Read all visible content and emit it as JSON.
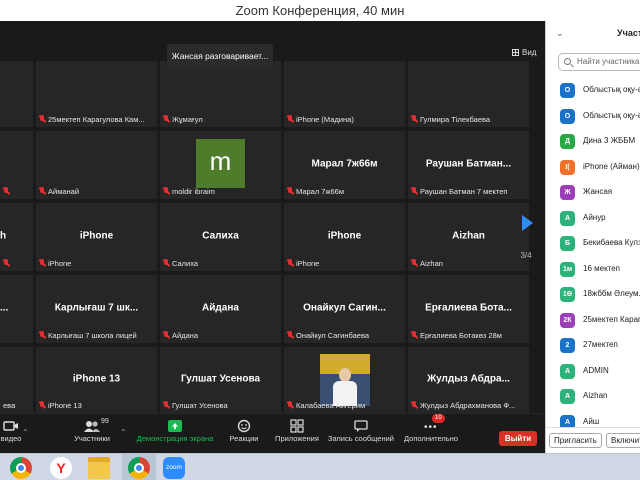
{
  "window": {
    "title": "Zoom Конференция, 40 мин"
  },
  "banner": {
    "speaking": "Жансая разговаривает..."
  },
  "view_button": {
    "label": "Вид"
  },
  "grid": {
    "row1": [
      {
        "caption": ""
      },
      {
        "caption": "25мектеп Карагулова Кам..."
      },
      {
        "caption": "Жұмағул"
      },
      {
        "caption": "iPhone (Мадина)"
      },
      {
        "caption": "Гулмира Тілекбаева"
      }
    ],
    "row2": [
      {
        "caption": ""
      },
      {
        "caption": "Айманай"
      },
      {
        "caption": "moldir ibraim",
        "avatar_letter": "m"
      },
      {
        "big": "Марал 7ж66м",
        "caption": "Марал 7ж66м"
      },
      {
        "big": "Раушан Батман...",
        "caption": "Раушан Батман 7 мектеп"
      }
    ],
    "row3": [
      {
        "big": "h"
      },
      {
        "big": "iPhone",
        "caption": "iPhone"
      },
      {
        "big": "Салиха",
        "caption": "Салиха"
      },
      {
        "big": "iPhone",
        "caption": "iPhone"
      },
      {
        "big": "Aizhan",
        "caption": "Aizhan"
      }
    ],
    "row4": [
      {
        "big": "..."
      },
      {
        "big": "Карлығаш 7 шк...",
        "caption": "Карлығаш 7 школа лицей"
      },
      {
        "big": "Айдана",
        "caption": "Айдана"
      },
      {
        "big": "Онайкул Сагин...",
        "caption": "Онайкул Сагинбаева"
      },
      {
        "big": "Ерғалиева Бота...",
        "caption": "Ерғалиева Ботакөз 28м"
      }
    ],
    "row5": [
      {
        "caption": "ева"
      },
      {
        "big": "iPhone 13",
        "caption": "iPhone 13"
      },
      {
        "big": "Гулшат Усенова",
        "caption": "Гулшат Усенова"
      },
      {
        "caption": "Калабаева Айгерим"
      },
      {
        "big": "Жулдыз Абдра...",
        "caption": "Жулдыз Абдрахманова Ф..."
      }
    ],
    "page_indicator": "3/4"
  },
  "toolbar": {
    "video": "видео",
    "participants": "Участники",
    "participants_count": "99",
    "share": "Демонстрация экрана",
    "reactions": "Реакции",
    "apps": "Приложения",
    "chat": "Запись сообщений",
    "more": "Дополнительно",
    "more_badge": "10",
    "leave": "Выйти"
  },
  "panel": {
    "title": "Участники",
    "search_placeholder": "Найти участника",
    "participants": [
      {
        "initials": "О",
        "name": "Облыстық оқу-ә...",
        "color": "#1a73c9"
      },
      {
        "initials": "О",
        "name": "Облыстық оқу-ә...",
        "color": "#1a73c9"
      },
      {
        "initials": "Д",
        "name": "Дина 3 ЖББМ",
        "color": "#28a745"
      },
      {
        "initials": "I(",
        "name": "iPhone (Айман)",
        "color": "#f0712b"
      },
      {
        "initials": "Ж",
        "name": "Жансая",
        "color": "#9b3fb8"
      },
      {
        "initials": "А",
        "name": "Айнур",
        "color": "#2db37a"
      },
      {
        "initials": "Б",
        "name": "Бекибаева Кулз...",
        "color": "#2db37a"
      },
      {
        "initials": "1м",
        "name": "16 мектеп",
        "color": "#2db37a"
      },
      {
        "initials": "1Ө",
        "name": "18жббм Әлеум...",
        "color": "#2db37a"
      },
      {
        "initials": "2К",
        "name": "25мектеп Караг...",
        "color": "#9b3fb8"
      },
      {
        "initials": "2",
        "name": "27мектеп",
        "color": "#1a73c9"
      },
      {
        "initials": "A",
        "name": "ADMIN",
        "color": "#2db37a"
      },
      {
        "initials": "A",
        "name": "Aizhan",
        "color": "#2db37a"
      },
      {
        "initials": "A",
        "name": "Айш",
        "color": "#1a73c9"
      }
    ],
    "invite_label": "Пригласить",
    "mute_label": "Включить"
  },
  "taskbar": {
    "apps": [
      "chrome-icon",
      "yandex-icon",
      "folder-icon",
      "chrome-icon",
      "zoom-icon"
    ],
    "zoom_label": "zoom",
    "yandex_letter": "Y"
  }
}
